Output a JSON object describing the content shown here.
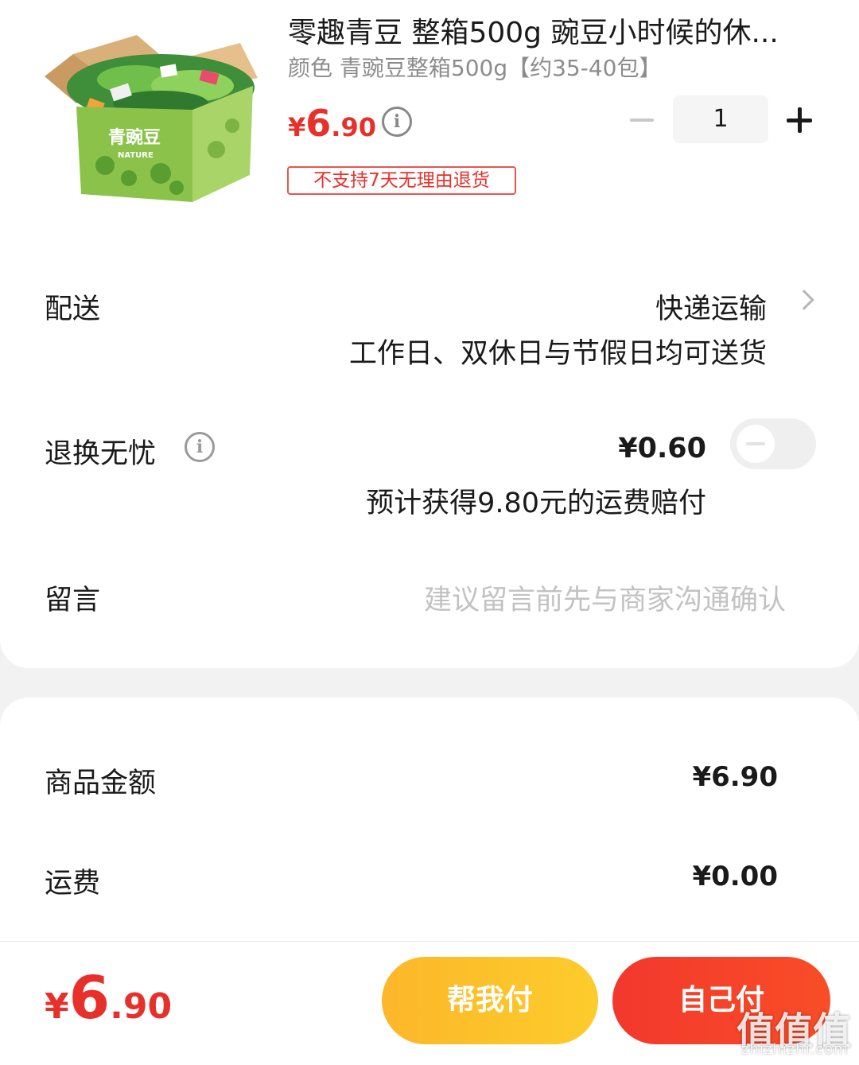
{
  "product": {
    "title": "零趣青豆 整箱500g 豌豆小时候的休...",
    "variant": "颜色 青豌豆整箱500g【约35-40包】",
    "price_symbol": "¥",
    "price_int": "6",
    "price_dec": ".90",
    "price_info_icon": "info-icon",
    "tag": "不支持7天无理由退货",
    "quantity": "1",
    "box_label": "青豌豆",
    "box_sub": "NATURE"
  },
  "delivery": {
    "label": "配送",
    "method": "快递运输",
    "note": "工作日、双休日与节假日均可送货"
  },
  "return_insurance": {
    "label": "退换无忧",
    "price": "¥0.60",
    "note": "预计获得9.80元的运费赔付",
    "enabled": false
  },
  "message": {
    "label": "留言",
    "placeholder": "建议留言前先与商家沟通确认"
  },
  "summary": {
    "goods_label": "商品金额",
    "goods_amount": "¥6.90",
    "shipping_label": "运费",
    "shipping_amount": "¥0.00"
  },
  "footer": {
    "total_symbol": "¥",
    "total_int": "6",
    "total_dec": ".90",
    "help_pay_label": "帮我付",
    "self_pay_label": "自己付"
  },
  "watermark": {
    "glyphs": "值值值",
    "site": "zhizhizhi.com"
  },
  "colors": {
    "price_red": "#e8302b",
    "help_pay_yellow": "#fcb72a",
    "self_pay_red": "#f2382d"
  }
}
